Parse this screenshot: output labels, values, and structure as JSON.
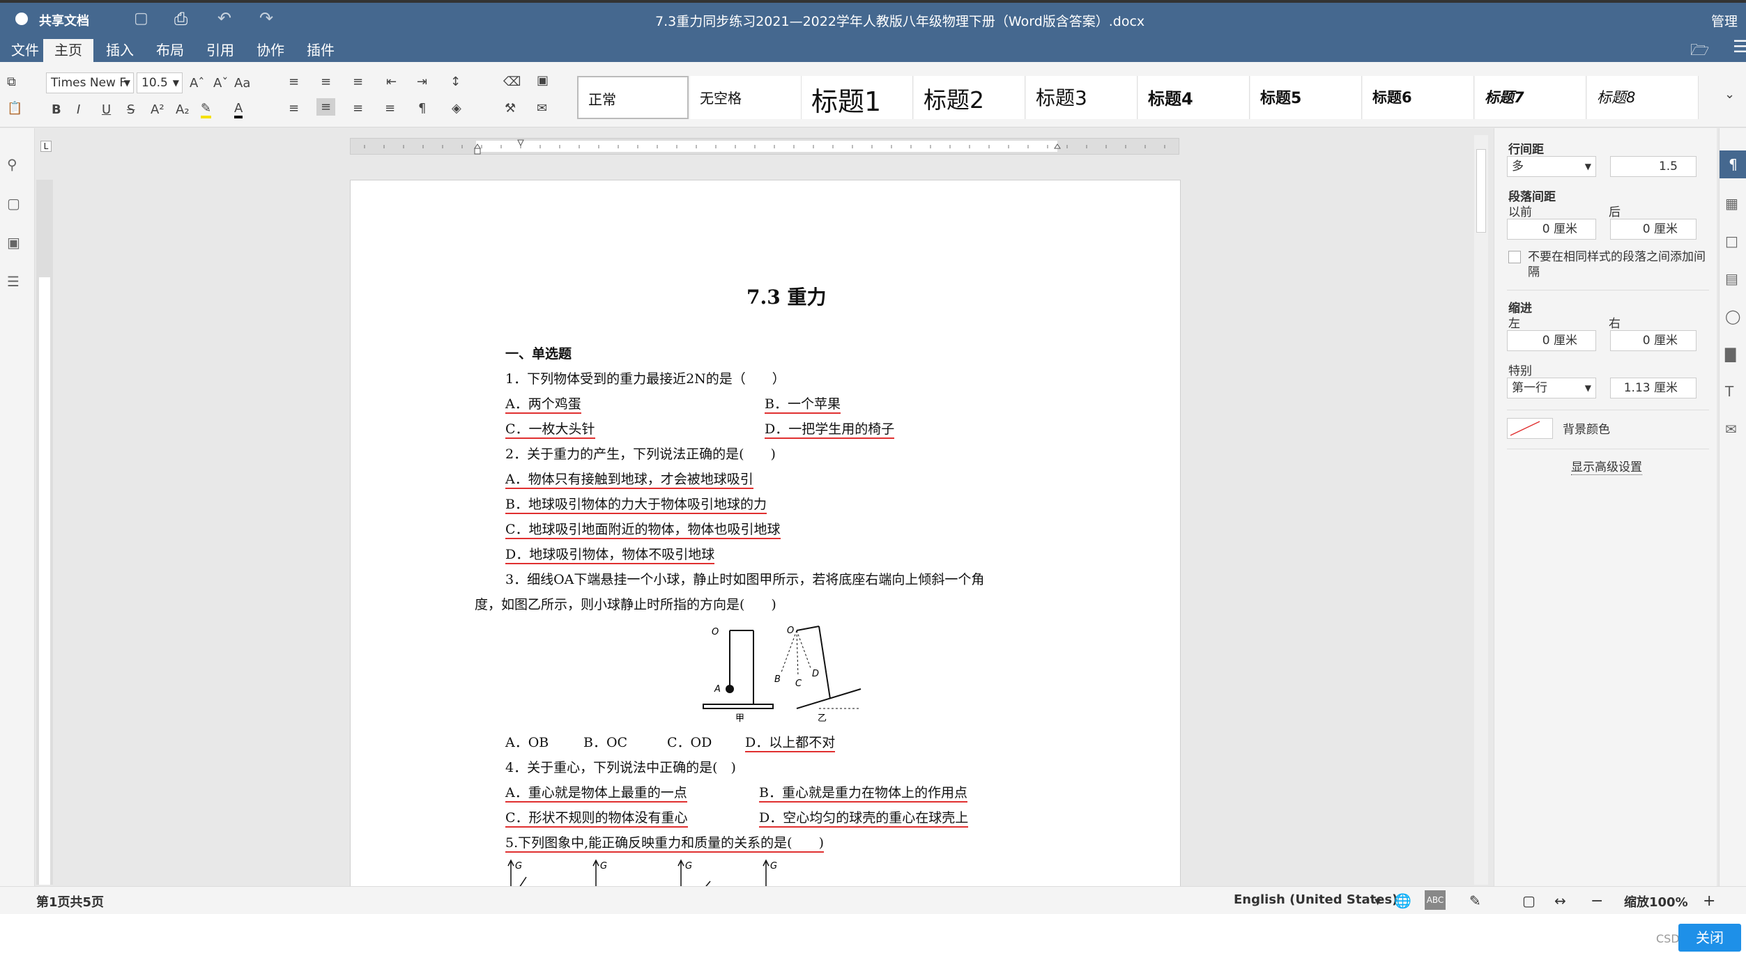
{
  "app": {
    "name": "共享文档",
    "doc_title": "7.3重力同步练习2021—2022学年人教版八年级物理下册（Word版含答案）.docx",
    "admin": "管理员"
  },
  "menu": [
    "文件",
    "主页",
    "插入",
    "布局",
    "引用",
    "协作",
    "插件"
  ],
  "ribbon": {
    "font_name": "Times New F",
    "font_size": "10.5",
    "styles": [
      "正常",
      "无空格",
      "标题1",
      "标题2",
      "标题3",
      "标题4",
      "标题5",
      "标题6",
      "标题7",
      "标题8"
    ]
  },
  "document": {
    "title": "7.3  重力",
    "section": "一、单选题",
    "q1": "1．下列物体受到的重力最接近2N的是（　　）",
    "q1_a": "A．两个鸡蛋",
    "q1_b": "B．一个苹果",
    "q1_c": "C．一枚大头针",
    "q1_d": "D．一把学生用的椅子",
    "q2": "2．关于重力的产生，下列说法正确的是(　　)",
    "q2_a": "A．物体只有接触到地球，才会被地球吸引",
    "q2_b": "B．地球吸引物体的力大于物体吸引地球的力",
    "q2_c": "C．地球吸引地面附近的物体，物体也吸引地球",
    "q2_d": "D．地球吸引物体，物体不吸引地球",
    "q3_line1": "3．细线OA下端悬挂一个小球，静止时如图甲所示，若将底座右端向上倾斜一个角",
    "q3_line2": "度，如图乙所示，则小球静止时所指的方向是(　　)",
    "fig_jia": "甲",
    "fig_yi": "乙",
    "fig_O": "O",
    "fig_A": "A",
    "fig_B": "B",
    "fig_C": "C",
    "fig_D": "D",
    "q3_a": "A．OB",
    "q3_b": "B．OC",
    "q3_c": "C．OD",
    "q3_d": "D．以上都不对",
    "q4": "4．关于重心，下列说法中正确的是(　)",
    "q4_a": "A．重心就是物体上最重的一点",
    "q4_b": "B．重心就是重力在物体上的作用点",
    "q4_c": "C．形状不规则的物体没有重心",
    "q4_d": "D．空心均匀的球壳的重心在球壳上",
    "q5": "5.下列图象中,能正确反映重力和质量的关系的是(　　)",
    "g_label": "G"
  },
  "right_panel": {
    "line_spacing_label": "行间距",
    "line_spacing_mode": "多",
    "line_spacing_value": "1.5",
    "para_spacing_label": "段落间距",
    "before_label": "以前",
    "after_label": "后",
    "before_value": "0 厘米",
    "after_value": "0 厘米",
    "no_space_checkbox": "不要在相同样式的段落之间添加间隔",
    "indent_label": "缩进",
    "left_label": "左",
    "right_label": "右",
    "left_value": "0 厘米",
    "right_value": "0 厘米",
    "special_label": "特别",
    "special_mode": "第一行",
    "special_value": "1.13 厘米",
    "bg_color_label": "背景颜色",
    "advanced_link": "显示高级设置"
  },
  "status": {
    "page_info": "第1页共5页",
    "language": "English (United States)",
    "zoom": "缩放100%"
  },
  "close_button": "关闭",
  "watermark": "CSDN @Kinsa"
}
